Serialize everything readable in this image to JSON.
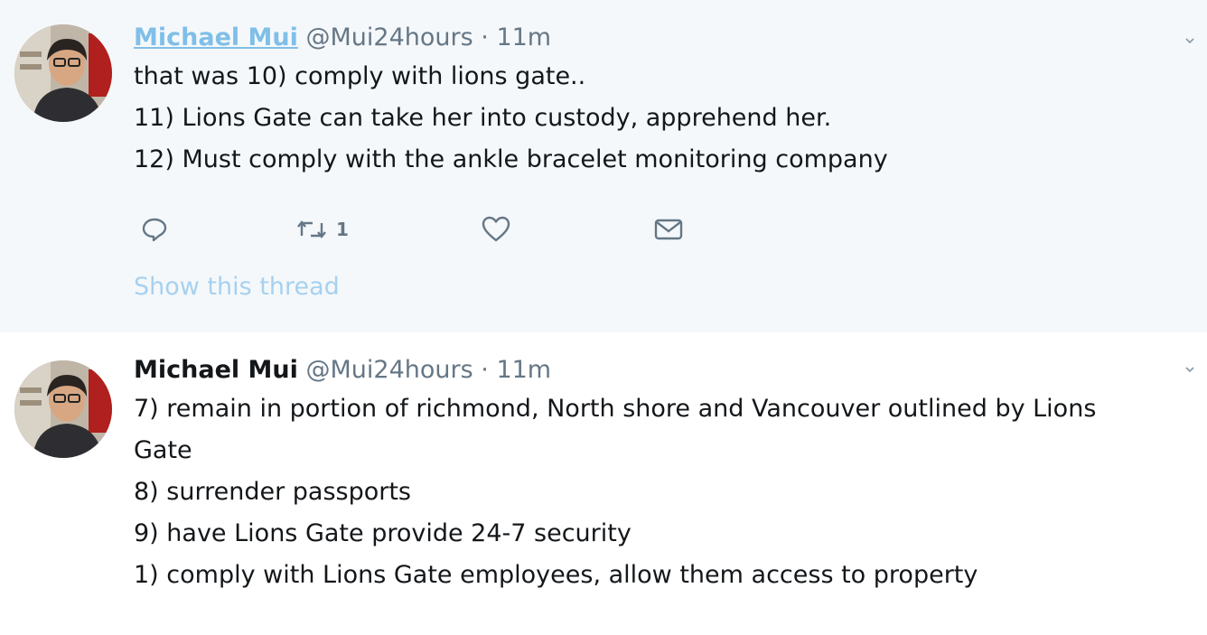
{
  "tweets": [
    {
      "display_name": "Michael Mui",
      "handle": "@Mui24hours",
      "separator": "·",
      "time": "11m",
      "lines": [
        "that was 10) comply with lions gate..",
        "11) Lions Gate can take her into custody, apprehend her.",
        "12) Must comply with the ankle bracelet monitoring company"
      ],
      "retweet_count": "1",
      "show_thread": "Show this thread"
    },
    {
      "display_name": "Michael Mui",
      "handle": "@Mui24hours",
      "separator": "·",
      "time": "11m",
      "lines": [
        "7) remain in portion of richmond, North shore and Vancouver outlined by Lions",
        "Gate",
        "8) surrender passports",
        "9) have Lions Gate provide 24-7 security",
        "1) comply with Lions Gate employees, allow them access to property"
      ]
    }
  ],
  "icons": {
    "reply": "reply-icon",
    "retweet": "retweet-icon",
    "like": "heart-icon",
    "dm": "envelope-icon",
    "menu": "chevron-down-icon"
  },
  "colors": {
    "highlight_background": "#f5f8fa",
    "link_blue": "#7fbfe8",
    "thread_link": "#a6d1f0",
    "secondary_text": "#657786"
  }
}
